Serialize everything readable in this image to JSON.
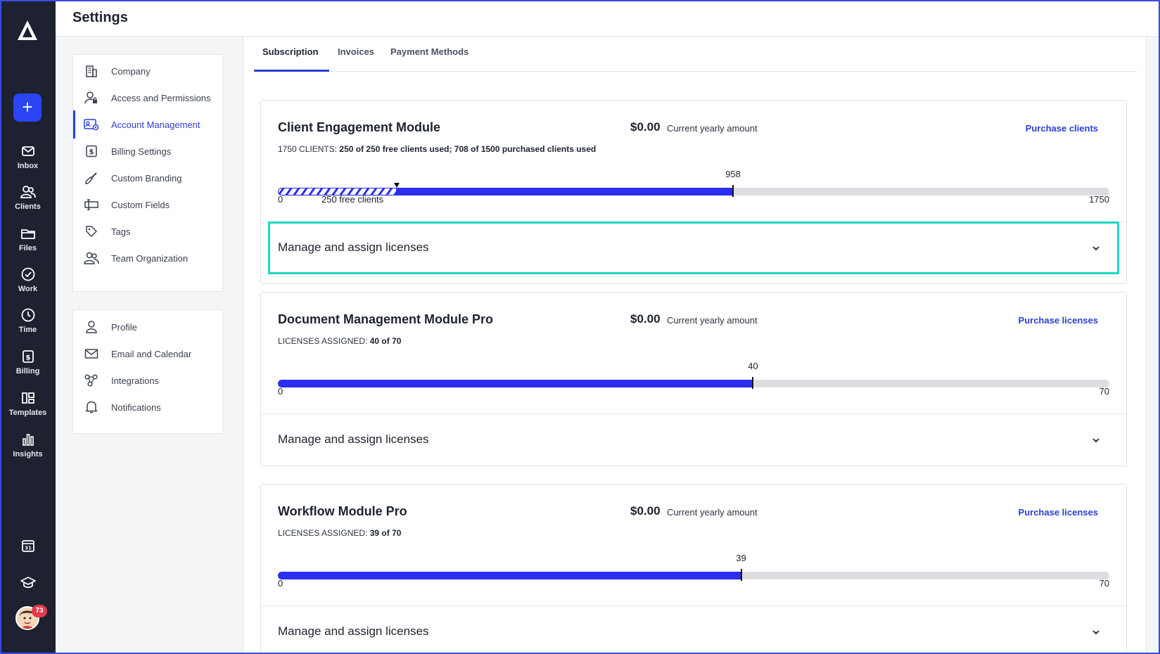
{
  "header": {
    "title": "Settings"
  },
  "rail": {
    "add_label": "+",
    "items": [
      {
        "label": "Inbox",
        "icon": "mail-icon"
      },
      {
        "label": "Clients",
        "icon": "users-icon"
      },
      {
        "label": "Files",
        "icon": "folder-icon"
      },
      {
        "label": "Work",
        "icon": "check-circle-icon"
      },
      {
        "label": "Time",
        "icon": "clock-icon"
      },
      {
        "label": "Billing",
        "icon": "dollar-icon"
      },
      {
        "label": "Templates",
        "icon": "templates-icon"
      },
      {
        "label": "Insights",
        "icon": "bar-chart-icon"
      }
    ],
    "calendar_day": "31",
    "notification_count": "73"
  },
  "settings_nav": {
    "group1": [
      {
        "label": "Company",
        "icon": "building-icon"
      },
      {
        "label": "Access and Permissions",
        "icon": "user-lock-icon"
      },
      {
        "label": "Account Management",
        "icon": "id-card-icon",
        "active": true
      },
      {
        "label": "Billing Settings",
        "icon": "dollar-doc-icon"
      },
      {
        "label": "Custom Branding",
        "icon": "paint-brush-icon"
      },
      {
        "label": "Custom Fields",
        "icon": "custom-field-icon"
      },
      {
        "label": "Tags",
        "icon": "tag-icon"
      },
      {
        "label": "Team Organization",
        "icon": "team-icon"
      }
    ],
    "group2": [
      {
        "label": "Profile",
        "icon": "person-icon"
      },
      {
        "label": "Email and Calendar",
        "icon": "envelope-icon"
      },
      {
        "label": "Integrations",
        "icon": "integrations-icon"
      },
      {
        "label": "Notifications",
        "icon": "bell-icon"
      }
    ]
  },
  "tabs": [
    {
      "label": "Subscription",
      "active": true
    },
    {
      "label": "Invoices"
    },
    {
      "label": "Payment Methods"
    }
  ],
  "modules": [
    {
      "title": "Client Engagement Module",
      "amount": "$0.00",
      "amount_label": "Current yearly amount",
      "purchase_label": "Purchase clients",
      "sub_prefix": "1750 CLIENTS:",
      "sub_value": "250 of 250 free clients used; 708 of 1500 purchased clients used",
      "bar": {
        "min": 0,
        "max": 1750,
        "free": 250,
        "used": 958
      },
      "min_label": "0",
      "max_label": "1750",
      "used_label": "958",
      "free_label": "250 free clients",
      "manage_label": "Manage and assign licenses"
    },
    {
      "title": "Document Management Module Pro",
      "amount": "$0.00",
      "amount_label": "Current yearly amount",
      "purchase_label": "Purchase licenses",
      "sub_prefix": "LICENSES ASSIGNED:",
      "sub_value": "40 of 70",
      "bar": {
        "min": 0,
        "max": 70,
        "used": 40
      },
      "min_label": "0",
      "max_label": "70",
      "used_label": "40",
      "manage_label": "Manage and assign licenses"
    },
    {
      "title": "Workflow Module Pro",
      "amount": "$0.00",
      "amount_label": "Current yearly amount",
      "purchase_label": "Purchase licenses",
      "sub_prefix": "LICENSES ASSIGNED:",
      "sub_value": "39 of 70",
      "bar": {
        "min": 0,
        "max": 70,
        "used": 39
      },
      "min_label": "0",
      "max_label": "70",
      "used_label": "39",
      "manage_label": "Manage and assign licenses"
    }
  ],
  "colors": {
    "accent": "#2b3ed6",
    "bar_fill": "#2b2ef0",
    "highlight": "#1fd8c0",
    "rail_bg": "#1d2130"
  }
}
